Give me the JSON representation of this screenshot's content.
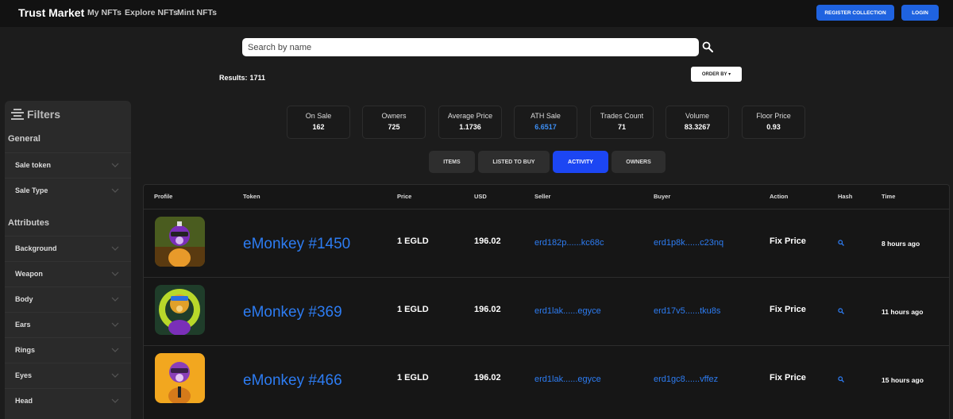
{
  "header": {
    "brand": "Trust Market",
    "nav": [
      "My NFTs",
      "Explore NFTs",
      "Mint NFTs"
    ],
    "register_label": "REGISTER COLLECTION",
    "login_label": "LOGIN"
  },
  "search": {
    "placeholder": "Search by name",
    "icon": "search-icon"
  },
  "results": {
    "label": "Results:",
    "count": "1711"
  },
  "order_by": "ORDER BY ▾",
  "sidebar": {
    "title": "Filters",
    "general_label": "General",
    "general": [
      "Sale token",
      "Sale Type"
    ],
    "attributes_label": "Attributes",
    "attributes": [
      "Background",
      "Weapon",
      "Body",
      "Ears",
      "Rings",
      "Eyes",
      "Head"
    ]
  },
  "stats": [
    {
      "label": "On Sale",
      "value": "162"
    },
    {
      "label": "Owners",
      "value": "725"
    },
    {
      "label": "Average Price",
      "value": "1.1736"
    },
    {
      "label": "ATH Sale",
      "value": "6.6517"
    },
    {
      "label": "Trades Count",
      "value": "71"
    },
    {
      "label": "Volume",
      "value": "83.3267"
    },
    {
      "label": "Floor Price",
      "value": "0.93"
    }
  ],
  "tabs": [
    "ITEMS",
    "LISTED TO BUY",
    "ACTIVITY",
    "OWNERS"
  ],
  "active_tab": "ACTIVITY",
  "table": {
    "headers": [
      "Profile",
      "Token",
      "Price",
      "USD",
      "Seller",
      "Buyer",
      "Action",
      "Hash",
      "Time"
    ],
    "rows": [
      {
        "token": "eMonkey #1450",
        "price": "1 EGLD",
        "usd": "196.02",
        "seller": "erd182p......kc68c",
        "buyer": "erd1p8k......c23nq",
        "action": "Fix Price",
        "time": "8 hours ago"
      },
      {
        "token": "eMonkey #369",
        "price": "1 EGLD",
        "usd": "196.02",
        "seller": "erd1lak......egyce",
        "buyer": "erd17v5......tku8s",
        "action": "Fix Price",
        "time": "11 hours ago"
      },
      {
        "token": "eMonkey #466",
        "price": "1 EGLD",
        "usd": "196.02",
        "seller": "erd1lak......egyce",
        "buyer": "erd1gc8......vffez",
        "action": "Fix Price",
        "time": "15 hours ago"
      }
    ]
  },
  "colors": {
    "accent": "#1f63e0",
    "active_tab": "#1c46f3",
    "link": "#2d7cf2",
    "ath": "#3d8ff5"
  }
}
